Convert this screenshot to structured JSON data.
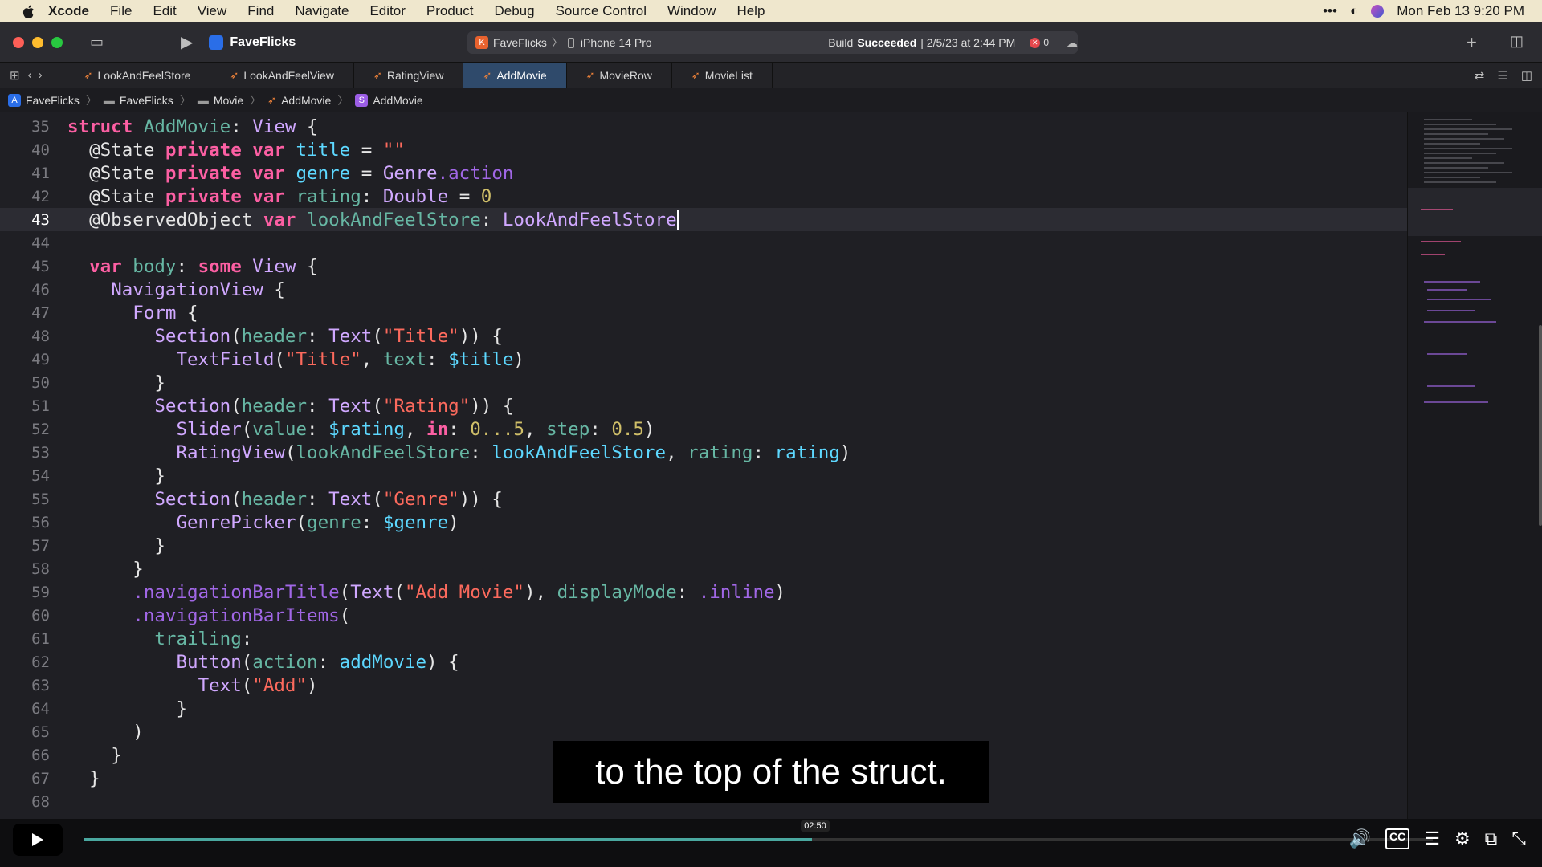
{
  "menubar": {
    "app": "Xcode",
    "items": [
      "File",
      "Edit",
      "View",
      "Find",
      "Navigate",
      "Editor",
      "Product",
      "Debug",
      "Source Control",
      "Window",
      "Help"
    ],
    "clock": "Mon Feb 13  9:20 PM"
  },
  "toolbar": {
    "project": "FaveFlicks",
    "scheme": "FaveFlicks",
    "device": "iPhone 14 Pro",
    "status_prefix": "Build",
    "status_bold": "Succeeded",
    "status_date": "| 2/5/23 at 2:44 PM",
    "errors": "0"
  },
  "tabs": [
    {
      "label": "LookAndFeelStore",
      "active": false
    },
    {
      "label": "LookAndFeelView",
      "active": false
    },
    {
      "label": "RatingView",
      "active": false
    },
    {
      "label": "AddMovie",
      "active": true
    },
    {
      "label": "MovieRow",
      "active": false
    },
    {
      "label": "MovieList",
      "active": false
    }
  ],
  "breadcrumb": [
    "FaveFlicks",
    "FaveFlicks",
    "Movie",
    "AddMovie",
    "AddMovie"
  ],
  "code_lines": [
    {
      "n": "35",
      "text": "struct AddMovie: View {"
    },
    {
      "n": "40",
      "text": "  @State private var title = \"\""
    },
    {
      "n": "41",
      "text": "  @State private var genre = Genre.action"
    },
    {
      "n": "42",
      "text": "  @State private var rating: Double = 0"
    },
    {
      "n": "43",
      "text": "  @ObservedObject var lookAndFeelStore: LookAndFeelStore"
    },
    {
      "n": "44",
      "text": ""
    },
    {
      "n": "45",
      "text": "  var body: some View {"
    },
    {
      "n": "46",
      "text": "    NavigationView {"
    },
    {
      "n": "47",
      "text": "      Form {"
    },
    {
      "n": "48",
      "text": "        Section(header: Text(\"Title\")) {"
    },
    {
      "n": "49",
      "text": "          TextField(\"Title\", text: $title)"
    },
    {
      "n": "50",
      "text": "        }"
    },
    {
      "n": "51",
      "text": "        Section(header: Text(\"Rating\")) {"
    },
    {
      "n": "52",
      "text": "          Slider(value: $rating, in: 0...5, step: 0.5)"
    },
    {
      "n": "53",
      "text": "          RatingView(lookAndFeelStore: lookAndFeelStore, rating: rating)"
    },
    {
      "n": "54",
      "text": "        }"
    },
    {
      "n": "55",
      "text": "        Section(header: Text(\"Genre\")) {"
    },
    {
      "n": "56",
      "text": "          GenrePicker(genre: $genre)"
    },
    {
      "n": "57",
      "text": "        }"
    },
    {
      "n": "58",
      "text": "      }"
    },
    {
      "n": "59",
      "text": "      .navigationBarTitle(Text(\"Add Movie\"), displayMode: .inline)"
    },
    {
      "n": "60",
      "text": "      .navigationBarItems("
    },
    {
      "n": "61",
      "text": "        trailing:"
    },
    {
      "n": "62",
      "text": "          Button(action: addMovie) {"
    },
    {
      "n": "63",
      "text": "            Text(\"Add\")"
    },
    {
      "n": "64",
      "text": "          }"
    },
    {
      "n": "65",
      "text": "      )"
    },
    {
      "n": "66",
      "text": "    }"
    },
    {
      "n": "67",
      "text": "  }"
    },
    {
      "n": "68",
      "text": ""
    }
  ],
  "current_line": "43",
  "caption": "to the top of the struct.",
  "player": {
    "time": "02:50",
    "progress": 0.54
  }
}
